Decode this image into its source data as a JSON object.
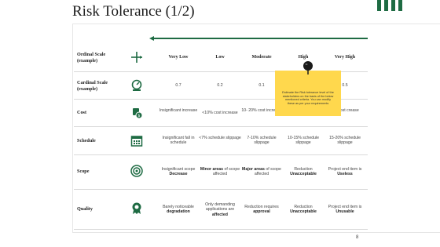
{
  "title": "Risk Tolerance (1/2)",
  "page_number": "8",
  "colors": {
    "accent": "#1e6b43",
    "note": "#ffd84d"
  },
  "header_row": {
    "label": "Ordinal Scale (example)",
    "icon": "arrow-cross-icon",
    "levels": [
      "Very Low",
      "Low",
      "Moderate",
      "High",
      "Very High"
    ]
  },
  "rows": [
    {
      "label": "Cardinal Scale (example)",
      "icon": "scale-icon",
      "cells": [
        "0.7",
        "0.2",
        "0.1",
        "",
        "0.5"
      ]
    },
    {
      "label": "Cost",
      "icon": "money-icon",
      "cells": [
        "Insignificant increase",
        "<10% cost increase",
        "10- 20% cost increase",
        "",
        "5% cost crease"
      ]
    },
    {
      "label": "Schedule",
      "icon": "calendar-icon",
      "cells": [
        "Insignificant fall in schedule",
        "<7% schedule slippage",
        "7-10% schedule slippage",
        "10-15% schedule slippage",
        "15-20% schedule slippage"
      ]
    },
    {
      "label": "Scope",
      "icon": "target-icon",
      "cells": [
        {
          "pre": "Insignificant scope",
          "bold": "Decrease",
          "post": ""
        },
        {
          "pre": "",
          "bold": "Minor areas",
          "post": " of scope affected"
        },
        {
          "pre": "",
          "bold": "Major areas",
          "post": " of scope affected"
        },
        {
          "pre": "Reduction",
          "bold": "Unacceptable",
          "post": ""
        },
        {
          "pre": "Project end item is",
          "bold": "Useless",
          "post": ""
        }
      ]
    },
    {
      "label": "Quality",
      "icon": "badge-icon",
      "cells": [
        {
          "pre": "Barely noticeable",
          "bold": "degradation",
          "post": ""
        },
        {
          "pre": "Only demanding applications are",
          "bold": "affected",
          "post": ""
        },
        {
          "pre": "Reduction requires",
          "bold": "approval",
          "post": ""
        },
        {
          "pre": "Reduction",
          "bold": "Unacceptable",
          "post": ""
        },
        {
          "pre": "Project end item is",
          "bold": "Unusable",
          "post": ""
        }
      ]
    }
  ],
  "sticky_note": {
    "icon": "pushpin-icon",
    "text": "Estimate the Risk tolerance level of the stakeholders on the basis of the below mentioned criteria. You can modify these as per your requirements"
  }
}
